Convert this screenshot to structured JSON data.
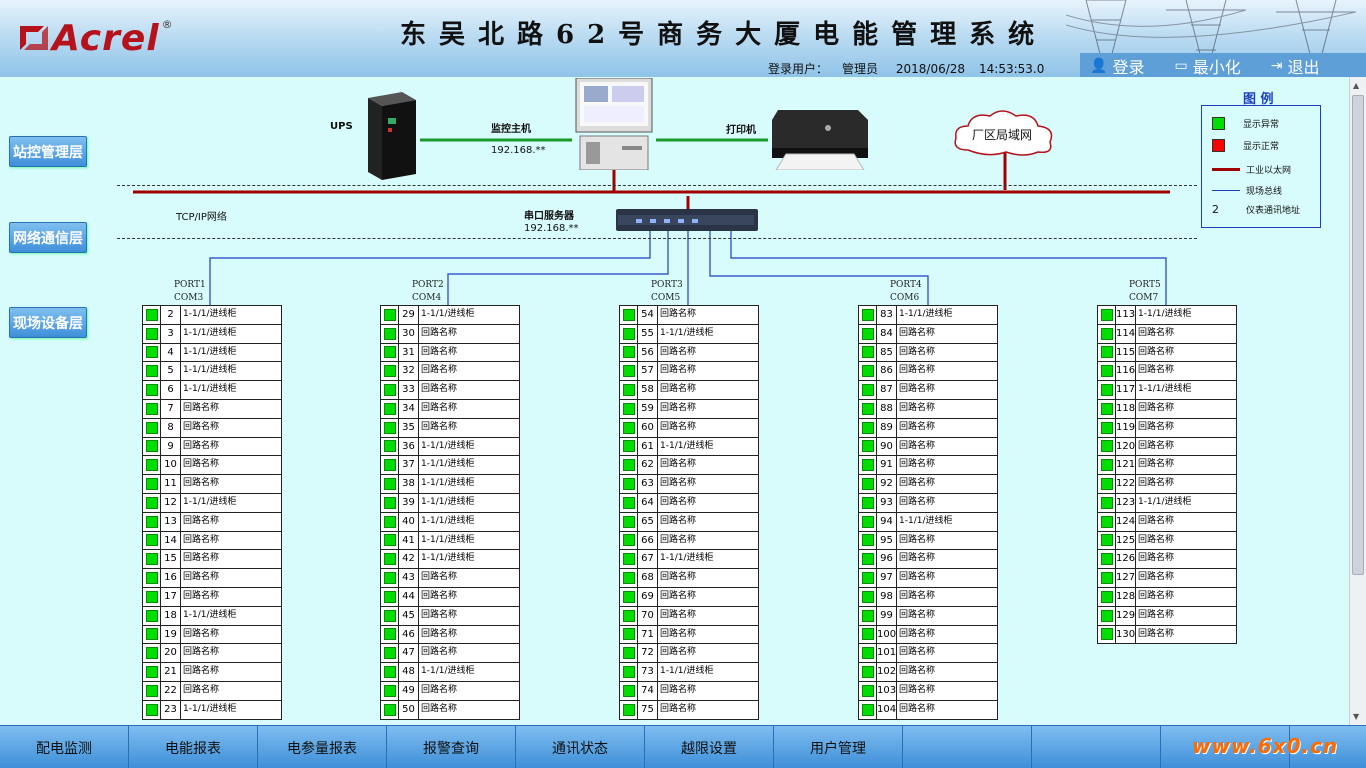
{
  "header": {
    "logo_text": "Acrel",
    "logo_reg": "®",
    "title": "东吴北路62号商务大厦电能管理系统",
    "user_label": "登录用户：",
    "user_name": "管理员",
    "date": "2018/06/28",
    "time": "14:53:53.0",
    "login_label": "登录",
    "minimize_label": "最小化",
    "exit_label": "退出"
  },
  "layers": {
    "station": "站控管理层",
    "network": "网络通信层",
    "field": "现场设备层"
  },
  "topology": {
    "ups_label": "UPS",
    "host_label": "监控主机",
    "host_ip": "192.168.**",
    "printer_label": "打印机",
    "lan_label": "厂区局域网",
    "tcpip_label": "TCP/IP网络",
    "serial_label": "串口服务器",
    "serial_ip": "192.168.**"
  },
  "legend": {
    "title": "图 例",
    "abnormal": "显示异常",
    "normal": "显示正常",
    "ethernet": "工业以太网",
    "fieldbus": "现场总线",
    "addr_num": "2",
    "addr_label": "仪表通讯地址",
    "colors": {
      "normal": "#00dd00",
      "abnormal": "#ff0000",
      "ethernet": "#a00000",
      "fieldbus": "#1b3fbf"
    }
  },
  "ports": [
    {
      "port": "PORT1",
      "com": "COM3",
      "rows": [
        {
          "n": "2",
          "name": "1-1/1/进线柜"
        },
        {
          "n": "3",
          "name": "1-1/1/进线柜"
        },
        {
          "n": "4",
          "name": "1-1/1/进线柜"
        },
        {
          "n": "5",
          "name": "1-1/1/进线柜"
        },
        {
          "n": "6",
          "name": "1-1/1/进线柜"
        },
        {
          "n": "7",
          "name": "回路名称"
        },
        {
          "n": "8",
          "name": "回路名称"
        },
        {
          "n": "9",
          "name": "回路名称"
        },
        {
          "n": "10",
          "name": "回路名称"
        },
        {
          "n": "11",
          "name": "回路名称"
        },
        {
          "n": "12",
          "name": "1-1/1/进线柜"
        },
        {
          "n": "13",
          "name": "回路名称"
        },
        {
          "n": "14",
          "name": "回路名称"
        },
        {
          "n": "15",
          "name": "回路名称"
        },
        {
          "n": "16",
          "name": "回路名称"
        },
        {
          "n": "17",
          "name": "回路名称"
        },
        {
          "n": "18",
          "name": "1-1/1/进线柜"
        },
        {
          "n": "19",
          "name": "回路名称"
        },
        {
          "n": "20",
          "name": "回路名称"
        },
        {
          "n": "21",
          "name": "回路名称"
        },
        {
          "n": "22",
          "name": "回路名称"
        },
        {
          "n": "23",
          "name": "1-1/1/进线柜"
        }
      ]
    },
    {
      "port": "PORT2",
      "com": "COM4",
      "rows": [
        {
          "n": "29",
          "name": "1-1/1/进线柜"
        },
        {
          "n": "30",
          "name": "回路名称"
        },
        {
          "n": "31",
          "name": "回路名称"
        },
        {
          "n": "32",
          "name": "回路名称"
        },
        {
          "n": "33",
          "name": "回路名称"
        },
        {
          "n": "34",
          "name": "回路名称"
        },
        {
          "n": "35",
          "name": "回路名称"
        },
        {
          "n": "36",
          "name": "1-1/1/进线柜"
        },
        {
          "n": "37",
          "name": "1-1/1/进线柜"
        },
        {
          "n": "38",
          "name": "1-1/1/进线柜"
        },
        {
          "n": "39",
          "name": "1-1/1/进线柜"
        },
        {
          "n": "40",
          "name": "1-1/1/进线柜"
        },
        {
          "n": "41",
          "name": "1-1/1/进线柜"
        },
        {
          "n": "42",
          "name": "1-1/1/进线柜"
        },
        {
          "n": "43",
          "name": "回路名称"
        },
        {
          "n": "44",
          "name": "回路名称"
        },
        {
          "n": "45",
          "name": "回路名称"
        },
        {
          "n": "46",
          "name": "回路名称"
        },
        {
          "n": "47",
          "name": "回路名称"
        },
        {
          "n": "48",
          "name": "1-1/1/进线柜"
        },
        {
          "n": "49",
          "name": "回路名称"
        },
        {
          "n": "50",
          "name": "回路名称"
        }
      ]
    },
    {
      "port": "PORT3",
      "com": "COM5",
      "rows": [
        {
          "n": "54",
          "name": "回路名称"
        },
        {
          "n": "55",
          "name": "1-1/1/进线柜"
        },
        {
          "n": "56",
          "name": "回路名称"
        },
        {
          "n": "57",
          "name": "回路名称"
        },
        {
          "n": "58",
          "name": "回路名称"
        },
        {
          "n": "59",
          "name": "回路名称"
        },
        {
          "n": "60",
          "name": "回路名称"
        },
        {
          "n": "61",
          "name": "1-1/1/进线柜"
        },
        {
          "n": "62",
          "name": "回路名称"
        },
        {
          "n": "63",
          "name": "回路名称"
        },
        {
          "n": "64",
          "name": "回路名称"
        },
        {
          "n": "65",
          "name": "回路名称"
        },
        {
          "n": "66",
          "name": "回路名称"
        },
        {
          "n": "67",
          "name": "1-1/1/进线柜"
        },
        {
          "n": "68",
          "name": "回路名称"
        },
        {
          "n": "69",
          "name": "回路名称"
        },
        {
          "n": "70",
          "name": "回路名称"
        },
        {
          "n": "71",
          "name": "回路名称"
        },
        {
          "n": "72",
          "name": "回路名称"
        },
        {
          "n": "73",
          "name": "1-1/1/进线柜"
        },
        {
          "n": "74",
          "name": "回路名称"
        },
        {
          "n": "75",
          "name": "回路名称"
        }
      ]
    },
    {
      "port": "PORT4",
      "com": "COM6",
      "rows": [
        {
          "n": "83",
          "name": "1-1/1/进线柜"
        },
        {
          "n": "84",
          "name": "回路名称"
        },
        {
          "n": "85",
          "name": "回路名称"
        },
        {
          "n": "86",
          "name": "回路名称"
        },
        {
          "n": "87",
          "name": "回路名称"
        },
        {
          "n": "88",
          "name": "回路名称"
        },
        {
          "n": "89",
          "name": "回路名称"
        },
        {
          "n": "90",
          "name": "回路名称"
        },
        {
          "n": "91",
          "name": "回路名称"
        },
        {
          "n": "92",
          "name": "回路名称"
        },
        {
          "n": "93",
          "name": "回路名称"
        },
        {
          "n": "94",
          "name": "1-1/1/进线柜"
        },
        {
          "n": "95",
          "name": "回路名称"
        },
        {
          "n": "96",
          "name": "回路名称"
        },
        {
          "n": "97",
          "name": "回路名称"
        },
        {
          "n": "98",
          "name": "回路名称"
        },
        {
          "n": "99",
          "name": "回路名称"
        },
        {
          "n": "100",
          "name": "回路名称"
        },
        {
          "n": "101",
          "name": "回路名称"
        },
        {
          "n": "102",
          "name": "回路名称"
        },
        {
          "n": "103",
          "name": "回路名称"
        },
        {
          "n": "104",
          "name": "回路名称"
        }
      ]
    },
    {
      "port": "PORT5",
      "com": "COM7",
      "rows": [
        {
          "n": "113",
          "name": "1-1/1/进线柜"
        },
        {
          "n": "114",
          "name": "回路名称"
        },
        {
          "n": "115",
          "name": "回路名称"
        },
        {
          "n": "116",
          "name": "回路名称"
        },
        {
          "n": "117",
          "name": "1-1/1/进线柜"
        },
        {
          "n": "118",
          "name": "回路名称"
        },
        {
          "n": "119",
          "name": "回路名称"
        },
        {
          "n": "120",
          "name": "回路名称"
        },
        {
          "n": "121",
          "name": "回路名称"
        },
        {
          "n": "122",
          "name": "回路名称"
        },
        {
          "n": "123",
          "name": "1-1/1/进线柜"
        },
        {
          "n": "124",
          "name": "回路名称"
        },
        {
          "n": "125",
          "name": "回路名称"
        },
        {
          "n": "126",
          "name": "回路名称"
        },
        {
          "n": "127",
          "name": "回路名称"
        },
        {
          "n": "128",
          "name": "回路名称"
        },
        {
          "n": "129",
          "name": "回路名称"
        },
        {
          "n": "130",
          "name": "回路名称"
        }
      ]
    }
  ],
  "nav": [
    "配电监测",
    "电能报表",
    "电参量报表",
    "报警查询",
    "通讯状态",
    "越限设置",
    "用户管理",
    "",
    "",
    ""
  ],
  "watermark": "www.6x0.cn"
}
